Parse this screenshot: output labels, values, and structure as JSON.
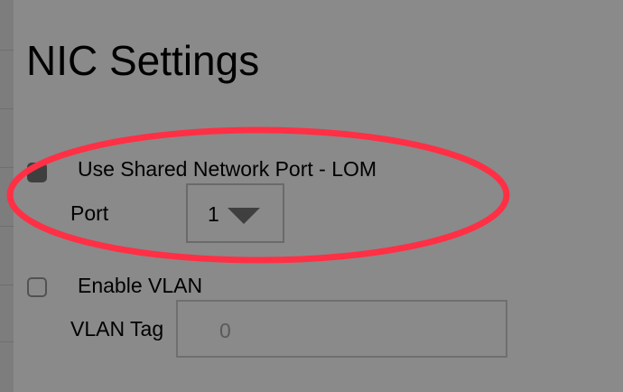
{
  "page": {
    "title": "NIC Settings"
  },
  "shared_port": {
    "label": "Use Shared Network Port - LOM",
    "checked": true
  },
  "port": {
    "label": "Port",
    "selected": "1"
  },
  "vlan": {
    "label": "Enable VLAN",
    "checked": false
  },
  "vlan_tag": {
    "label": "VLAN Tag",
    "value": "0"
  },
  "annotation": {
    "color": "#ff3045"
  },
  "colors": {
    "background": "#8a8a8a",
    "checkbox_checked": "#3f3f3f"
  }
}
